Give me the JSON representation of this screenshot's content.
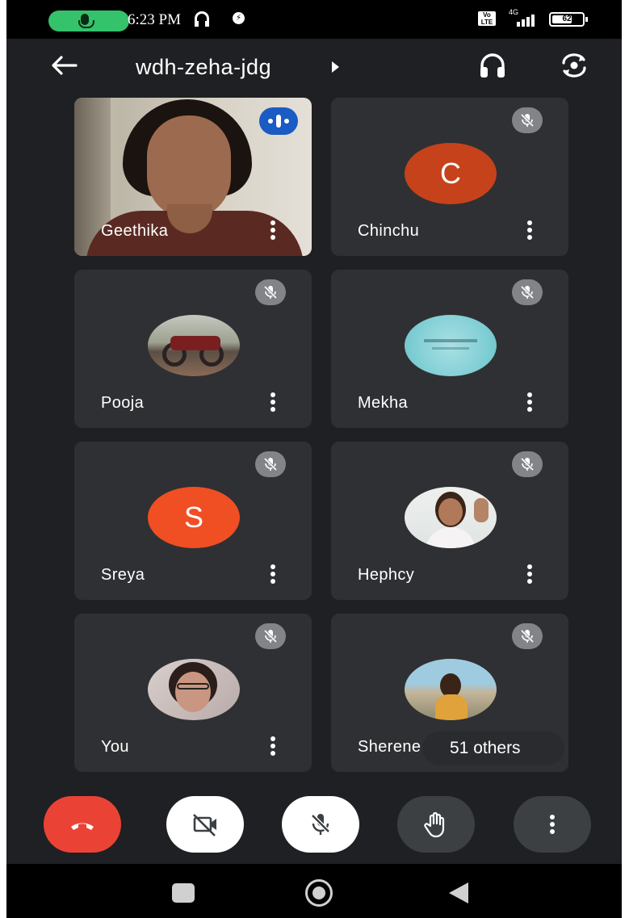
{
  "status_bar": {
    "time": "6:23 PM",
    "volte_label": "Vo LTE",
    "network_label": "4G",
    "battery_level": "62"
  },
  "header": {
    "meeting_code": "wdh-zeha-jdg",
    "icons": [
      "back-arrow-icon",
      "headphones-icon",
      "switch-camera-icon"
    ]
  },
  "participants": [
    {
      "name": "Geethika",
      "type": "video",
      "speaking": true
    },
    {
      "name": "Chinchu",
      "type": "letter",
      "initial": "C",
      "color": "#c6421b",
      "muted": true
    },
    {
      "name": "Pooja",
      "type": "photo",
      "muted": true
    },
    {
      "name": "Mekha",
      "type": "photo",
      "muted": true
    },
    {
      "name": "Sreya",
      "type": "letter",
      "initial": "S",
      "color": "#f04e23",
      "muted": true
    },
    {
      "name": "Hephcy",
      "type": "photo",
      "muted": true
    },
    {
      "name": "You",
      "type": "photo",
      "muted": true
    },
    {
      "name": "Sherene",
      "type": "photo",
      "muted": true
    }
  ],
  "others_chip": "51 others",
  "controls": {
    "end_call_color": "#ea4335",
    "icons": [
      "end-call-icon",
      "camera-off-icon",
      "mic-off-icon",
      "raise-hand-icon",
      "more-options-icon"
    ]
  },
  "colors": {
    "background": "#1f2023",
    "tile": "#2f3033",
    "speaking_badge": "#1a5bc4"
  }
}
